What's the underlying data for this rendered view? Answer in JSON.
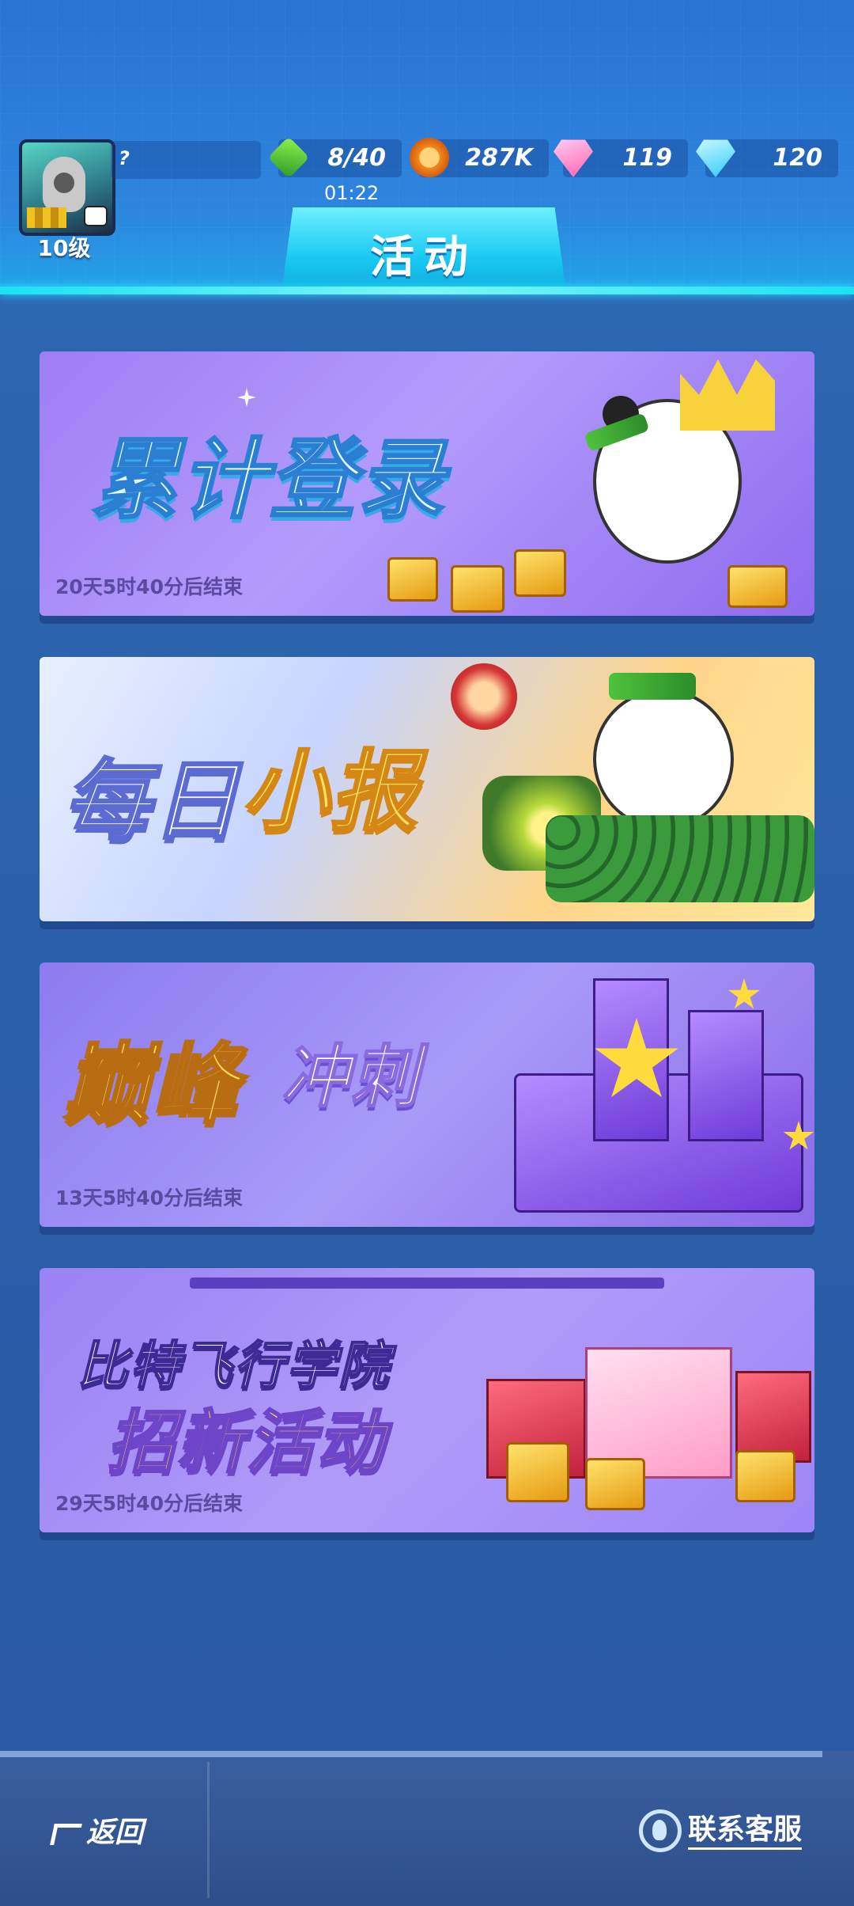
{
  "header": {
    "player_name": "?",
    "level": "10级",
    "energy": "8/40",
    "energy_timer": "01:22",
    "coins": "287K",
    "gems": "119",
    "diamonds": "120",
    "title": "活动"
  },
  "banners": [
    {
      "title": "累计登录",
      "countdown": "20天5时40分后结束"
    },
    {
      "title_part1": "每日",
      "title_part2": "小报",
      "countdown": ""
    },
    {
      "title_part1": "巅峰",
      "title_part2": "冲刺",
      "countdown": "13天5时40分后结束"
    },
    {
      "title_line1": "比特飞行学院",
      "title_line2": "招新活动",
      "countdown": "29天5时40分后结束"
    }
  ],
  "footer": {
    "back_label": "返回",
    "support_label": "联系客服"
  },
  "colors": {
    "accent": "#1de0f5",
    "header_bg": "#2a74d4",
    "page_bg": "#2a5ea8"
  }
}
